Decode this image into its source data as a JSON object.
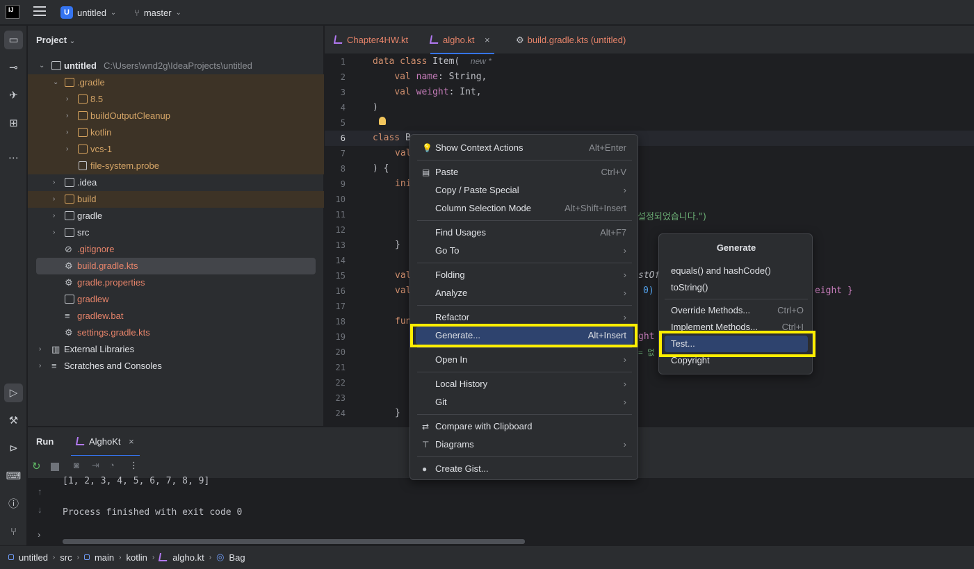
{
  "titlebar": {
    "project_badge": "U",
    "project_name": "untitled",
    "branch": "master"
  },
  "project_panel": {
    "title": "Project",
    "root": {
      "name": "untitled",
      "path": "C:\\Users\\wnd2g\\IdeaProjects\\untitled"
    },
    "items": [
      {
        "label": ".gradle"
      },
      {
        "label": "8.5"
      },
      {
        "label": "buildOutputCleanup"
      },
      {
        "label": "kotlin"
      },
      {
        "label": "vcs-1"
      },
      {
        "label": "file-system.probe"
      },
      {
        "label": ".idea"
      },
      {
        "label": "build"
      },
      {
        "label": "gradle"
      },
      {
        "label": "src"
      },
      {
        "label": ".gitignore"
      },
      {
        "label": "build.gradle.kts"
      },
      {
        "label": "gradle.properties"
      },
      {
        "label": "gradlew"
      },
      {
        "label": "gradlew.bat"
      },
      {
        "label": "settings.gradle.kts"
      },
      {
        "label": "External Libraries"
      },
      {
        "label": "Scratches and Consoles"
      }
    ]
  },
  "editor_tabs": [
    {
      "label": "Chapter4HW.kt"
    },
    {
      "label": "algho.kt"
    },
    {
      "label": "build.gradle.kts (untitled)"
    }
  ],
  "gutter": [
    "1",
    "2",
    "3",
    "4",
    "5",
    "6",
    "7",
    "8",
    "9",
    "10",
    "11",
    "12",
    "13",
    "14",
    "15",
    "16",
    "17",
    "18",
    "19",
    "20",
    "21",
    "22",
    "23",
    "24"
  ],
  "code": {
    "l1": {
      "kw": "data class",
      "rest": " Item(",
      "hint": "new *"
    },
    "l2": {
      "kw": "val",
      "prop": "name",
      "rest": ": String,"
    },
    "l3": {
      "kw": "val",
      "prop": "weight",
      "rest": ": Int,"
    },
    "l4": ")",
    "l6": {
      "kw": "class",
      "rest": " B"
    },
    "l7": "val",
    "l8": ") {",
    "l9": "ini",
    "l11": "설정되었습니다.\")",
    "l13": "}",
    "l15a": "val",
    "l15b": "stOf",
    "l16a": "val",
    "l16b": "0)",
    "l16c": "eight }",
    "l18a": "fun",
    "l19": "ght",
    "l20": "= 없",
    "l24": "}"
  },
  "run_panel": {
    "tab_run": "Run",
    "tab_config": "AlghoKt",
    "output_line1": "[1, 2, 3, 4, 5, 6, 7, 8, 9]",
    "output_line2": "Process finished with exit code 0"
  },
  "breadcrumb": [
    "untitled",
    "src",
    "main",
    "kotlin",
    "algho.kt",
    "Bag"
  ],
  "context_menu": {
    "items": [
      {
        "label": "Show Context Actions",
        "shortcut": "Alt+Enter"
      },
      {
        "label": "Paste",
        "shortcut": "Ctrl+V"
      },
      {
        "label": "Copy / Paste Special",
        "shortcut": "›"
      },
      {
        "label": "Column Selection Mode",
        "shortcut": "Alt+Shift+Insert"
      },
      {
        "label": "Find Usages",
        "shortcut": "Alt+F7"
      },
      {
        "label": "Go To",
        "shortcut": "›"
      },
      {
        "label": "Folding",
        "shortcut": "›"
      },
      {
        "label": "Analyze",
        "shortcut": "›"
      },
      {
        "label": "Refactor",
        "shortcut": "›"
      },
      {
        "label": "Generate...",
        "shortcut": "Alt+Insert"
      },
      {
        "label": "Open In",
        "shortcut": "›"
      },
      {
        "label": "Local History",
        "shortcut": "›"
      },
      {
        "label": "Git",
        "shortcut": "›"
      },
      {
        "label": "Compare with Clipboard",
        "shortcut": ""
      },
      {
        "label": "Diagrams",
        "shortcut": "›"
      },
      {
        "label": "Create Gist...",
        "shortcut": ""
      }
    ]
  },
  "generate_menu": {
    "title": "Generate",
    "items": [
      {
        "label": "equals() and hashCode()",
        "shortcut": ""
      },
      {
        "label": "toString()",
        "shortcut": ""
      },
      {
        "label": "Override Methods...",
        "shortcut": "Ctrl+O"
      },
      {
        "label": "Implement Methods...",
        "shortcut": "Ctrl+I"
      },
      {
        "label": "Test...",
        "shortcut": ""
      },
      {
        "label": "Copyright",
        "shortcut": ""
      }
    ]
  },
  "colors": {
    "accent": "#3574f0",
    "highlight_box": "#ffee00",
    "menu_selection": "#2e436e"
  }
}
